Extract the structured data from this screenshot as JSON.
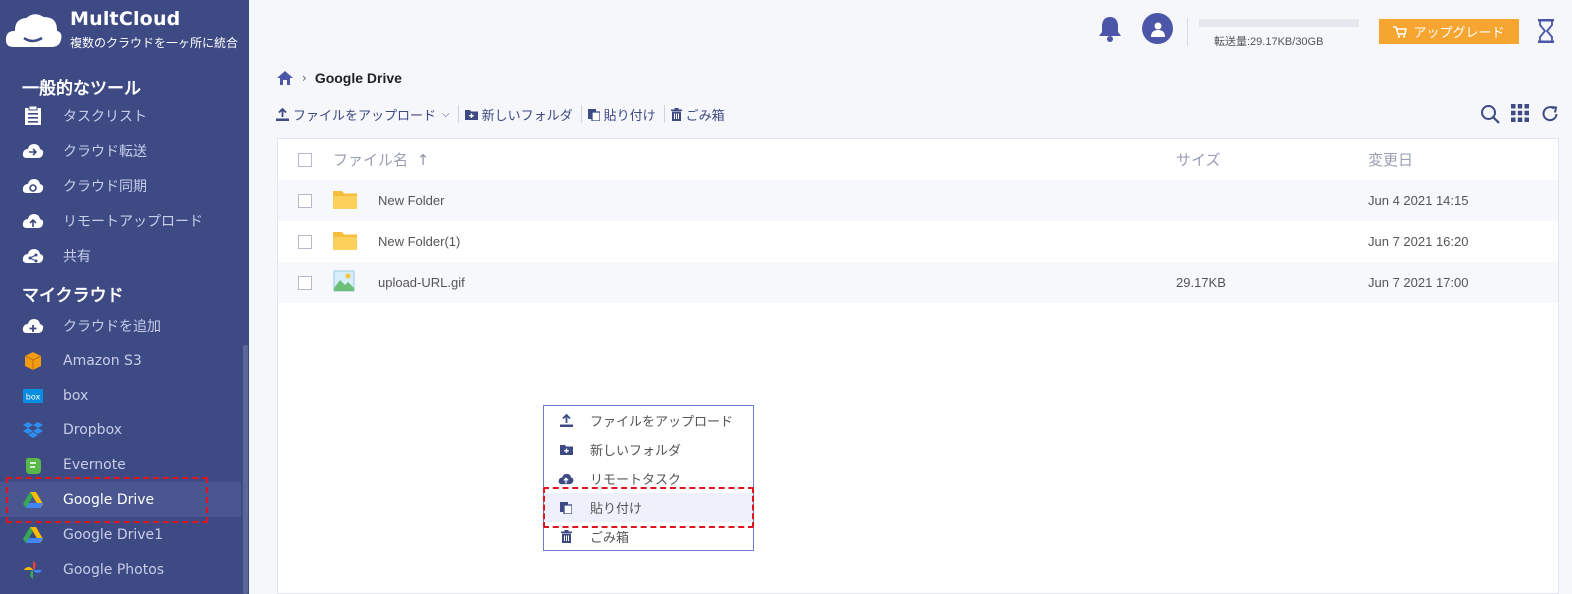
{
  "brand": {
    "name": "MultCloud",
    "tagline": "複数のクラウドを一ヶ所に統合"
  },
  "sidebar": {
    "tools_title": "一般的なツール",
    "tools": [
      {
        "label": "タスクリスト",
        "icon": "tasklist-icon"
      },
      {
        "label": "クラウド転送",
        "icon": "cloud-transfer-icon"
      },
      {
        "label": "クラウド同期",
        "icon": "cloud-sync-icon"
      },
      {
        "label": "リモートアップロード",
        "icon": "remote-upload-icon"
      },
      {
        "label": "共有",
        "icon": "share-icon"
      }
    ],
    "clouds_title": "マイクラウド",
    "clouds": [
      {
        "label": "クラウドを追加",
        "icon": "add-cloud-icon"
      },
      {
        "label": "Amazon S3",
        "icon": "amazon-s3-icon"
      },
      {
        "label": "box",
        "icon": "box-icon"
      },
      {
        "label": "Dropbox",
        "icon": "dropbox-icon"
      },
      {
        "label": "Evernote",
        "icon": "evernote-icon"
      },
      {
        "label": "Google Drive",
        "icon": "google-drive-icon",
        "active": true
      },
      {
        "label": "Google Drive1",
        "icon": "google-drive-icon"
      },
      {
        "label": "Google Photos",
        "icon": "google-photos-icon"
      }
    ]
  },
  "topbar": {
    "usage_text": "転送量:29.17KB/30GB",
    "upgrade_label": "アップグレード"
  },
  "breadcrumb": {
    "current": "Google Drive"
  },
  "toolbar": {
    "upload": "ファイルをアップロード",
    "new_folder": "新しいフォルダ",
    "paste": "貼り付け",
    "trash": "ごみ箱"
  },
  "table": {
    "headers": {
      "name": "ファイル名",
      "size": "サイズ",
      "date": "変更日"
    },
    "rows": [
      {
        "name": "New Folder",
        "size": "",
        "date": "Jun 4 2021 14:15",
        "type": "folder"
      },
      {
        "name": "New Folder(1)",
        "size": "",
        "date": "Jun 7 2021 16:20",
        "type": "folder"
      },
      {
        "name": "upload-URL.gif",
        "size": "29.17KB",
        "date": "Jun 7 2021 17:00",
        "type": "image"
      }
    ]
  },
  "context_menu": [
    {
      "label": "ファイルをアップロード",
      "icon": "upload-icon"
    },
    {
      "label": "新しいフォルダ",
      "icon": "new-folder-icon"
    },
    {
      "label": "リモートタスク",
      "icon": "remote-task-icon"
    },
    {
      "label": "貼り付け",
      "icon": "paste-icon"
    },
    {
      "label": "ごみ箱",
      "icon": "trash-icon"
    }
  ],
  "colors": {
    "sidebar": "#3d4a84",
    "accent": "#4b56a8",
    "upgrade": "#f6a530",
    "highlight": "#e0141e"
  }
}
